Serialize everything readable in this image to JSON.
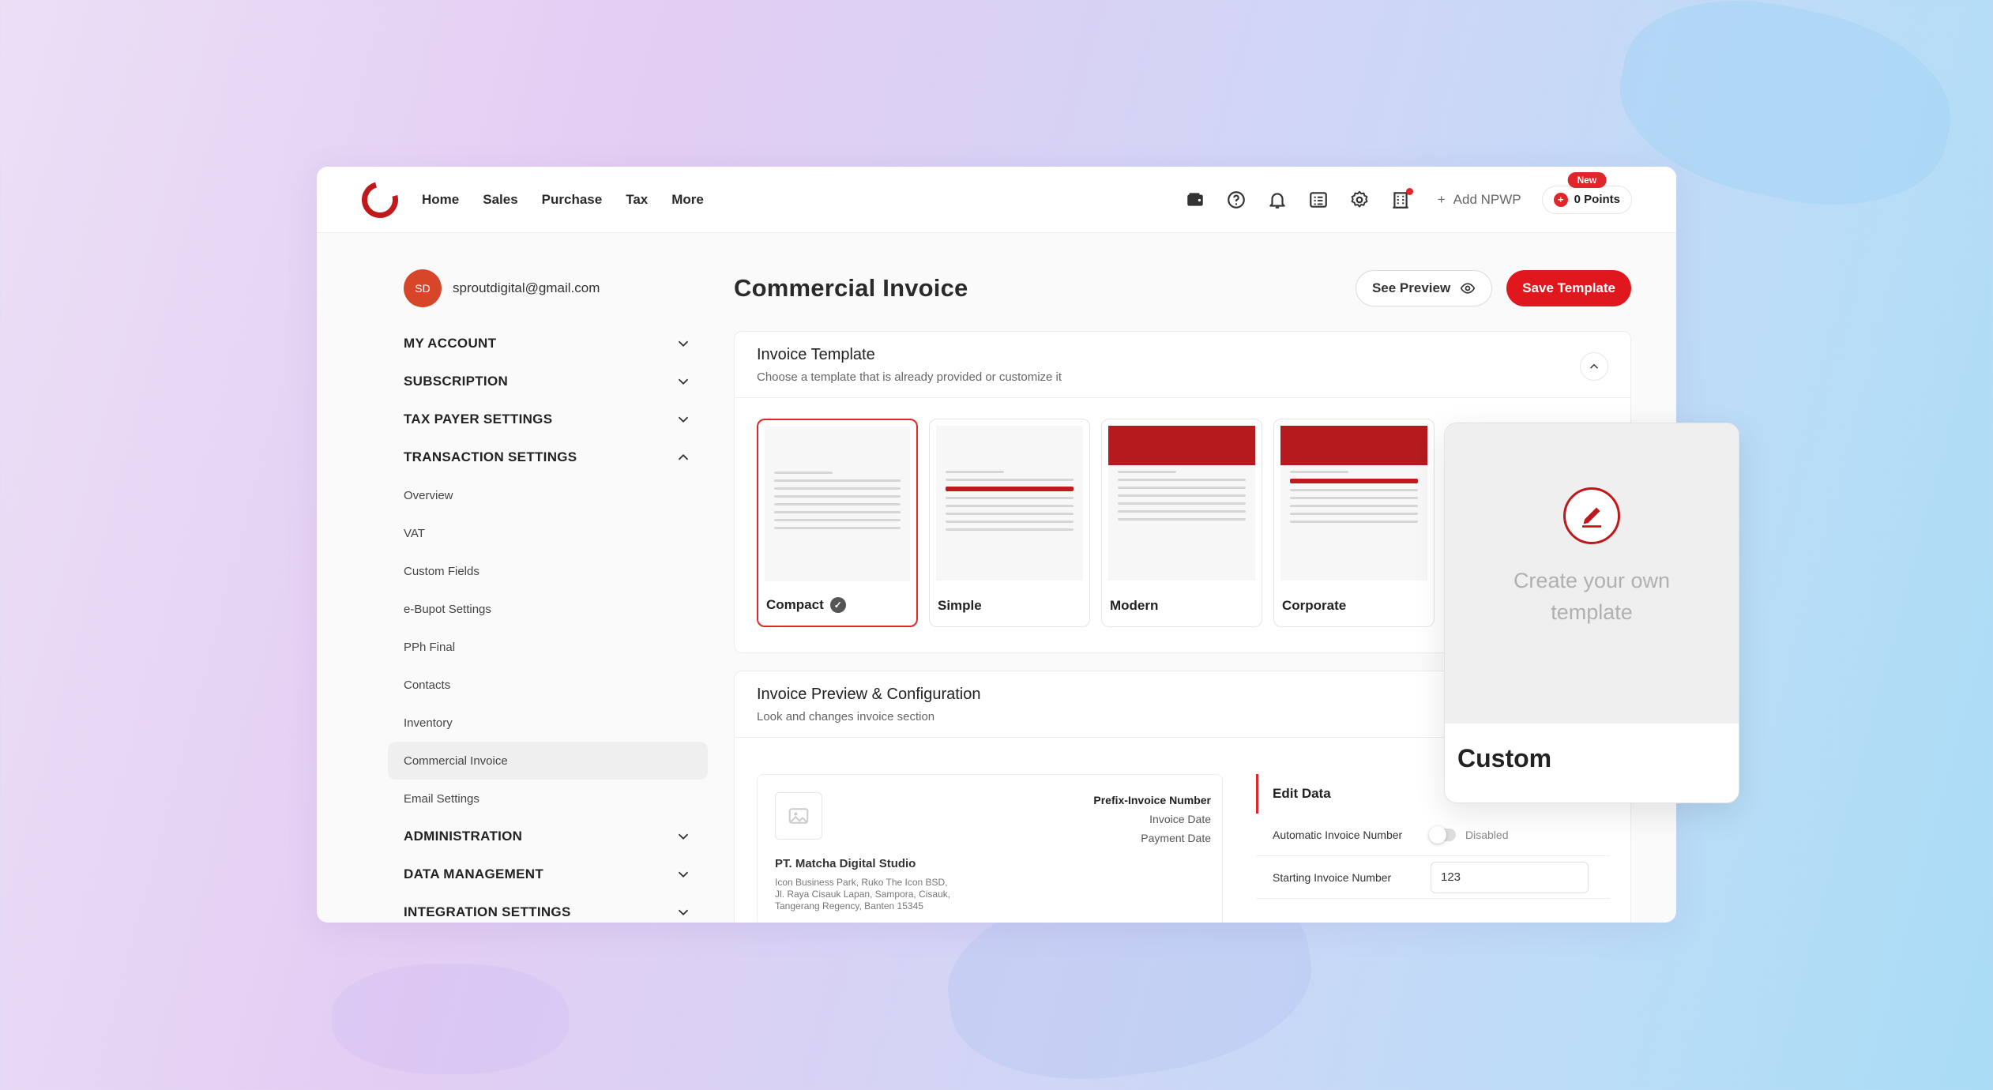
{
  "nav": {
    "items": [
      "Home",
      "Sales",
      "Purchase",
      "Tax",
      "More"
    ],
    "add_npwp": "Add NPWP",
    "points_badge": "New",
    "points": "0 Points"
  },
  "account": {
    "initials": "SD",
    "email": "sproutdigital@gmail.com"
  },
  "sidebar": {
    "sections_top": [
      "MY ACCOUNT",
      "SUBSCRIPTION",
      "TAX PAYER SETTINGS",
      "TRANSACTION SETTINGS"
    ],
    "sub_items": [
      "Overview",
      "VAT",
      "Custom Fields",
      "e-Bupot Settings",
      "PPh Final",
      "Contacts",
      "Inventory",
      "Commercial Invoice",
      "Email Settings"
    ],
    "active_sub": "Commercial Invoice",
    "sections_bottom": [
      "ADMINISTRATION",
      "DATA MANAGEMENT",
      "INTEGRATION SETTINGS"
    ]
  },
  "main": {
    "title": "Commercial Invoice",
    "see_preview": "See Preview",
    "save_template": "Save Template"
  },
  "template_card": {
    "title": "Invoice Template",
    "subtitle": "Choose a template that is already provided or customize it",
    "templates": [
      "Compact",
      "Simple",
      "Modern",
      "Corporate"
    ],
    "selected": "Compact"
  },
  "preview_card": {
    "title": "Invoice Preview & Configuration",
    "subtitle": "Look and changes invoice section",
    "invoice": {
      "prefix": "Prefix-Invoice Number",
      "date": "Invoice Date",
      "payment": "Payment Date",
      "company": "PT. Matcha Digital Studio",
      "address_1": "Icon Business Park, Ruko The Icon BSD,",
      "address_2": "Jl. Raya Cisauk Lapan, Sampora, Cisauk,",
      "address_3": "Tangerang Regency, Banten 15345"
    },
    "edit": {
      "title": "Edit Data",
      "auto_label": "Automatic Invoice Number",
      "auto_state": "Disabled",
      "start_label": "Starting Invoice Number",
      "start_value": "123"
    }
  },
  "custom_card": {
    "create_text": "Create your own template",
    "label": "Custom"
  },
  "colors": {
    "accent": "#e0181d",
    "brand": "#c0191c"
  }
}
